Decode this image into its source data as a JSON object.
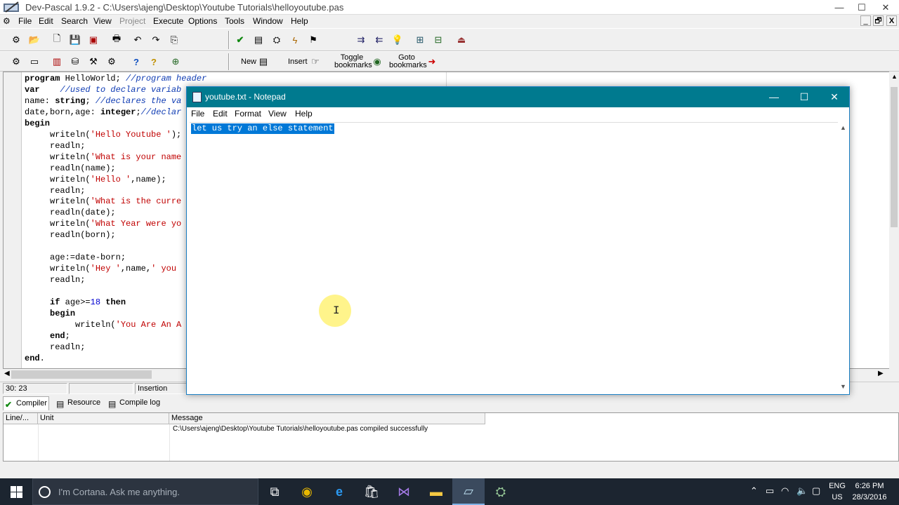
{
  "window": {
    "title": "Dev-Pascal 1.9.2 - C:\\Users\\ajeng\\Desktop\\Youtube Tutorials\\helloyoutube.pas",
    "min": "—",
    "max": "☐",
    "close": "✕"
  },
  "menu": [
    "File",
    "Edit",
    "Search",
    "View",
    "Project",
    "Execute",
    "Options",
    "Tools",
    "Window",
    "Help"
  ],
  "mdi": {
    "min": "_",
    "restore": "🗗",
    "close": "X"
  },
  "toolbar2": {
    "new_label": "New",
    "insert_label": "Insert",
    "toggle_label1": "Toggle",
    "toggle_label2": "bookmarks",
    "goto_label1": "Goto",
    "goto_label2": "bookmarks"
  },
  "editor": {
    "lines": [
      "program HelloWorld; //program header",
      "var    //used to declare variab",
      "name: string; //declares the va",
      "date,born,age: integer;//declar",
      "begin",
      "     writeln('Hello Youtube ');",
      "     readln;",
      "     writeln('What is your name",
      "     readln(name);",
      "     writeln('Hello ',name);",
      "     readln;",
      "     writeln('What is the curre",
      "     readln(date);",
      "     writeln('What Year were yo",
      "     readln(born);",
      "",
      "     age:=date-born;",
      "     writeln('Hey ',name,' you",
      "     readln;",
      "",
      "     if age>=18 then",
      "     begin",
      "          writeln('You Are An A",
      "     end;",
      "     readln;",
      "end."
    ]
  },
  "status": {
    "position": "30: 23",
    "modified": "",
    "mode": "Insertion"
  },
  "bottom_tabs": [
    "Compiler",
    "Resource",
    "Compile log"
  ],
  "messages": {
    "columns": [
      "Line/...",
      "Unit",
      "Message"
    ],
    "rows": [
      {
        "line": "",
        "unit": "",
        "message": "C:\\Users\\ajeng\\Desktop\\Youtube Tutorials\\helloyoutube.pas compiled successfully"
      }
    ]
  },
  "notepad": {
    "title": "youtube.txt - Notepad",
    "menu": [
      "File",
      "Edit",
      "Format",
      "View",
      "Help"
    ],
    "content": "let us try an else statement",
    "min": "—",
    "max": "☐",
    "close": "✕"
  },
  "taskbar": {
    "cortana_placeholder": "I'm Cortana. Ask me anything.",
    "lang1": "ENG",
    "lang2": "US",
    "time": "6:26 PM",
    "date": "28/3/2016"
  }
}
